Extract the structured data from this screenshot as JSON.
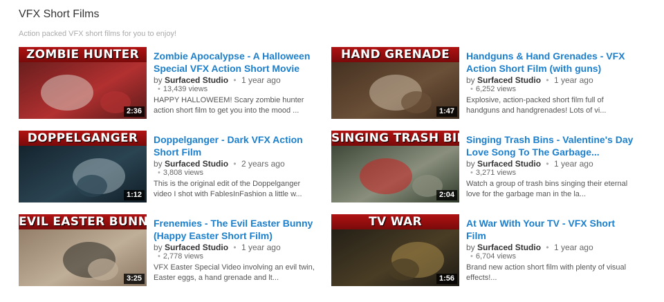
{
  "shelf": {
    "title": "VFX Short Films",
    "description": "Action packed VFX short films for you to enjoy!"
  },
  "videos": [
    {
      "thumb_title": "ZOMBIE HUNTER",
      "duration": "2:36",
      "title": "Zombie Apocalypse - A Halloween Special VFX Action Short Movie",
      "by": "by",
      "author": "Surfaced Studio",
      "age": "1 year ago",
      "views": "13,439 views",
      "description": "HAPPY HALLOWEEM! Scary zombie hunter action short film to get you into the mood ...",
      "palette": [
        "#5b1a1a",
        "#b23030",
        "#d9c8c0"
      ]
    },
    {
      "thumb_title": "HAND GRENADE",
      "duration": "1:47",
      "title": "Handguns & Hand Grenades - VFX Action Short Film (with guns)",
      "by": "by",
      "author": "Surfaced Studio",
      "age": "1 year ago",
      "views": "6,252 views",
      "description": "Explosive, action-packed short film full of handguns and handgrenades! Lots of vi...",
      "palette": [
        "#3d2a1c",
        "#6b5038",
        "#c9b8a3"
      ]
    },
    {
      "thumb_title": "DOPPELGANGER",
      "duration": "1:12",
      "title": "Doppelganger - Dark VFX Action Short Film",
      "by": "by",
      "author": "Surfaced Studio",
      "age": "2 years ago",
      "views": "3,808 views",
      "description": "This is the original edit of the Doppelganger video I shot with FablesInFashion a little w...",
      "palette": [
        "#0f1d26",
        "#2b4452",
        "#9fb1b8"
      ]
    },
    {
      "thumb_title": "SINGING TRASH BINS",
      "duration": "2:04",
      "title": "Singing Trash Bins - Valentine's Day Love Song To The Garbage...",
      "by": "by",
      "author": "Surfaced Studio",
      "age": "1 year ago",
      "views": "3,271 views",
      "description": "Watch a group of trash bins singing their eternal love for the garbage man in the la...",
      "palette": [
        "#2f3a2a",
        "#8a8f7d",
        "#c92222"
      ]
    },
    {
      "thumb_title": "EVIL EASTER BUNNY",
      "duration": "3:25",
      "title": "Frenemies - The Evil Easter Bunny (Happy Easter Short Film)",
      "by": "by",
      "author": "Surfaced Studio",
      "age": "1 year ago",
      "views": "2,778 views",
      "description": "VFX Easter Special Video involving an evil twin, Easter eggs, a hand grenade and lt...",
      "palette": [
        "#8a7560",
        "#bfae98",
        "#2a2a22"
      ]
    },
    {
      "thumb_title": "TV WAR",
      "duration": "1:56",
      "title": "At War With Your TV - VFX Short Film",
      "by": "by",
      "author": "Surfaced Studio",
      "age": "1 year ago",
      "views": "6,704 views",
      "description": "Brand new action short film with plenty of visual effects!...",
      "palette": [
        "#1c1a14",
        "#4a3d25",
        "#a88a4a"
      ]
    }
  ]
}
